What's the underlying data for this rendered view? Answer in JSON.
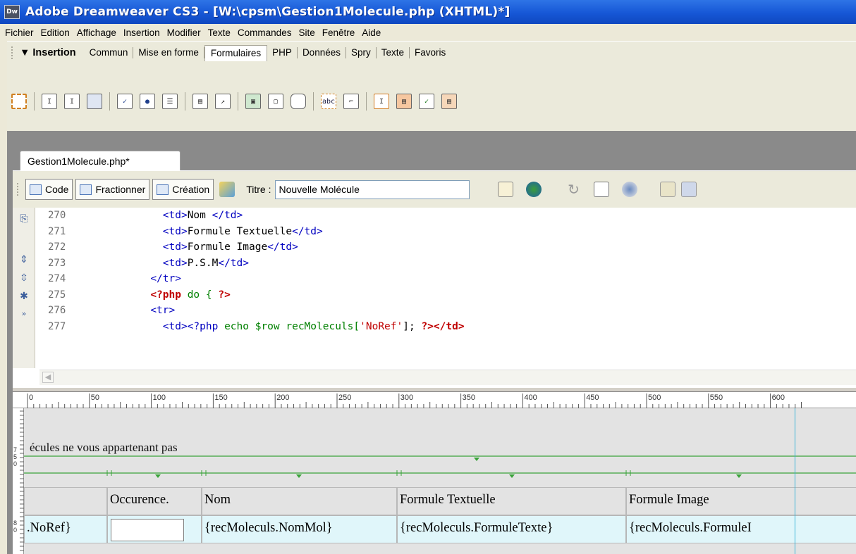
{
  "window": {
    "title": "Adobe Dreamweaver CS3 - [W:\\cpsm\\Gestion1Molecule.php (XHTML)*]",
    "logo": "Dw"
  },
  "menu": [
    "Fichier",
    "Edition",
    "Affichage",
    "Insertion",
    "Modifier",
    "Texte",
    "Commandes",
    "Site",
    "Fenêtre",
    "Aide"
  ],
  "insert_panel": {
    "title": "▼ Insertion",
    "tabs": [
      "Commun",
      "Mise en forme",
      "Formulaires",
      "PHP",
      "Données",
      "Spry",
      "Texte",
      "Favoris"
    ],
    "active_tab": "Formulaires",
    "form_icons": [
      "form-icon",
      "text-field-icon",
      "hidden-field-icon",
      "textarea-icon",
      "checkbox-icon",
      "radio-button-icon",
      "radio-group-icon",
      "list-menu-icon",
      "jump-menu-icon",
      "image-field-icon",
      "file-field-icon",
      "button-icon",
      "label-icon",
      "fieldset-icon",
      "spry-text-field-icon",
      "spry-select-icon",
      "spry-checkbox-icon",
      "spry-textarea-icon"
    ],
    "abc_label": "abc"
  },
  "document": {
    "tab_label": "Gestion1Molecule.php*",
    "toolbar": {
      "code": "Code",
      "split": "Fractionner",
      "design": "Création",
      "title_label": "Titre :",
      "title_value": "Nouvelle Molécule"
    }
  },
  "code": {
    "line_numbers": [
      "270",
      "271",
      "272",
      "273",
      "274",
      "275",
      "276",
      "277"
    ],
    "lines": [
      [
        "            ",
        "<td>",
        "Nom ",
        "</td>"
      ],
      [
        "            ",
        "<td>",
        "Formule Textuelle",
        "</td>"
      ],
      [
        "            ",
        "<td>",
        "Formule Image",
        "</td>"
      ],
      [
        "            ",
        "<td>",
        "P.S.M",
        "</td>"
      ],
      [
        "          ",
        "</tr>",
        "",
        ""
      ],
      [
        "          ",
        "<?php",
        " do { ",
        "?>"
      ],
      [
        "          ",
        "<tr>",
        "",
        ""
      ],
      [
        "            ",
        "<td><?php",
        " echo $row recMoleculs[",
        "'NoRef'",
        "]; ",
        "?></td>"
      ]
    ]
  },
  "ruler": {
    "ticks": [
      "0",
      "50",
      "100",
      "150",
      "200",
      "250",
      "300",
      "350",
      "400",
      "450",
      "500",
      "550",
      "600"
    ]
  },
  "vruler": [
    "7",
    "5",
    "0",
    "8",
    "0"
  ],
  "design": {
    "text": "écules ne vous appartenant pas",
    "headers": [
      "",
      "Occurence.",
      "Nom",
      "Formule Textuelle",
      "Formule Image"
    ],
    "row": [
      ".NoRef}",
      "",
      "{recMoleculs.NomMol}",
      "{recMoleculs.FormuleTexte}",
      "{recMoleculs.FormuleI"
    ]
  }
}
